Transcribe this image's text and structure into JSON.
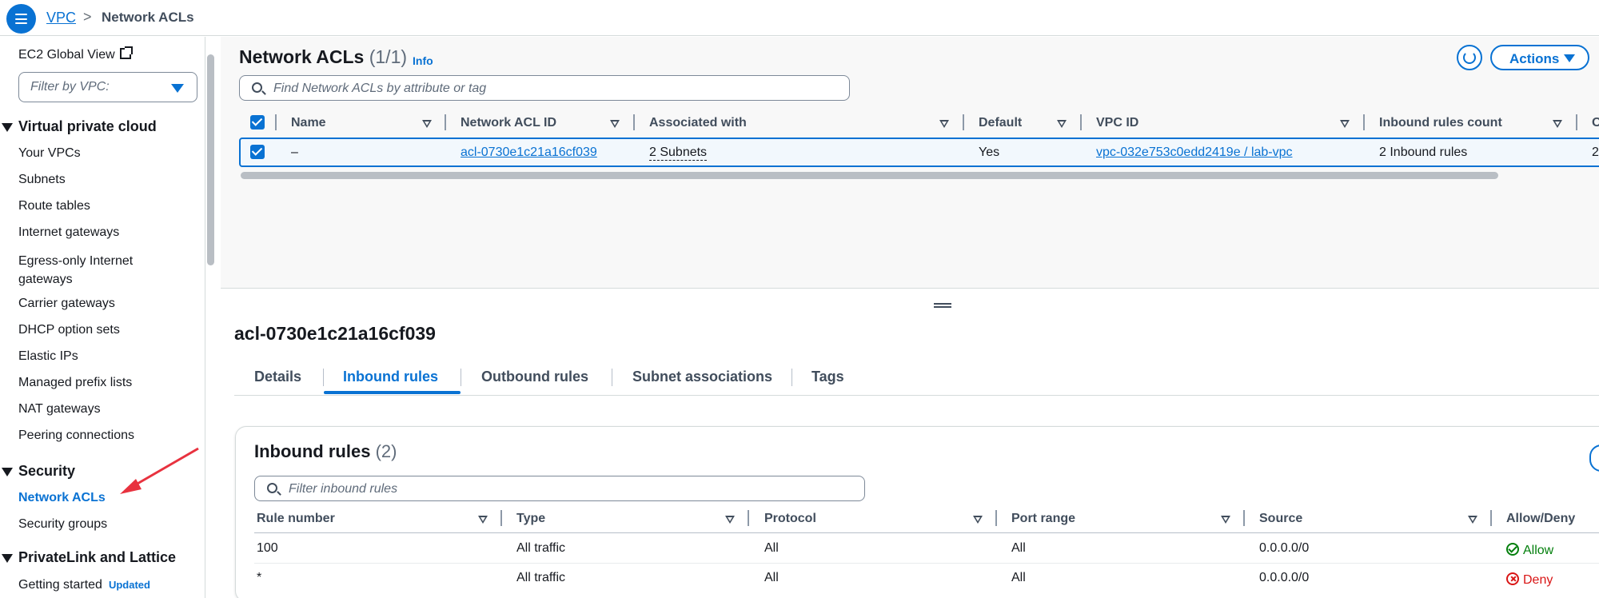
{
  "breadcrumb": {
    "root": "VPC",
    "separator": ">",
    "current": "Network ACLs"
  },
  "sidebar": {
    "global_view": "EC2 Global View",
    "vpc_filter_placeholder": "Filter by VPC:",
    "section_vpc": "Virtual private cloud",
    "vpc_items": [
      "Your VPCs",
      "Subnets",
      "Route tables",
      "Internet gateways",
      "Egress-only Internet gateways",
      "Carrier gateways",
      "DHCP option sets",
      "Elastic IPs",
      "Managed prefix lists",
      "NAT gateways",
      "Peering connections"
    ],
    "section_security": "Security",
    "security_items": [
      "Network ACLs",
      "Security groups"
    ],
    "active_item": "Network ACLs",
    "section_privatelink": "PrivateLink and Lattice",
    "privatelink_items": [
      "Getting started"
    ],
    "badge_updated": "Updated"
  },
  "header": {
    "title": "Network ACLs",
    "count": "(1/1)",
    "info": "Info",
    "actions_label": "Actions",
    "search_placeholder": "Find Network ACLs by attribute or tag"
  },
  "acl_table": {
    "columns": [
      "Name",
      "Network ACL ID",
      "Associated with",
      "Default",
      "VPC ID",
      "Inbound rules count",
      "O"
    ],
    "rows": [
      {
        "name": "–",
        "acl_id": "acl-0730e1c21a16cf039",
        "associated": "2 Subnets",
        "default": "Yes",
        "vpc_id": "vpc-032e753c0edd2419e / lab-vpc",
        "inbound_count": "2 Inbound rules",
        "overflow": "2"
      }
    ]
  },
  "detail": {
    "title": "acl-0730e1c21a16cf039",
    "tabs": [
      "Details",
      "Inbound rules",
      "Outbound rules",
      "Subnet associations",
      "Tags"
    ],
    "active_tab": "Inbound rules"
  },
  "inbound": {
    "title": "Inbound rules",
    "count": "(2)",
    "filter_placeholder": "Filter inbound rules",
    "columns": [
      "Rule number",
      "Type",
      "Protocol",
      "Port range",
      "Source",
      "Allow/Deny"
    ],
    "rows": [
      {
        "rule": "100",
        "type": "All traffic",
        "protocol": "All",
        "port": "All",
        "source": "0.0.0.0/0",
        "action": "Allow"
      },
      {
        "rule": "*",
        "type": "All traffic",
        "protocol": "All",
        "port": "All",
        "source": "0.0.0.0/0",
        "action": "Deny"
      }
    ]
  },
  "colors": {
    "accent": "#0972d3",
    "allow": "#037f0c",
    "deny": "#d91515",
    "annotation_arrow": "#e8323f"
  }
}
